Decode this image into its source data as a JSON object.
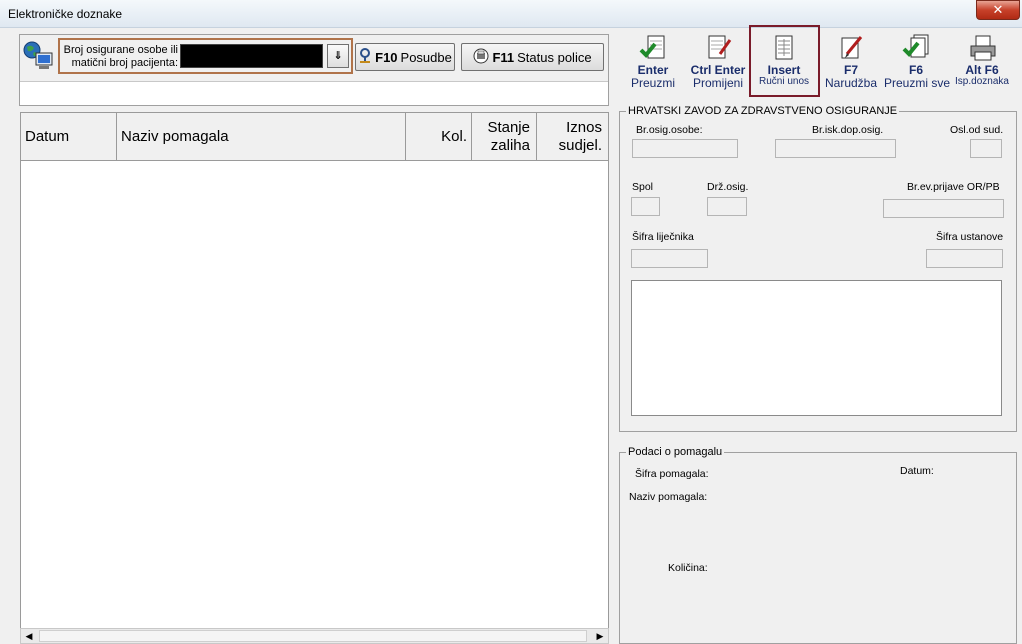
{
  "window": {
    "title": "Elektroničke doznake",
    "close_glyph": "✕"
  },
  "search": {
    "label": "Broj osigurane osobe ili matični broj pacijenta:",
    "value": "",
    "dropdown_glyph": "⇓"
  },
  "buttons": {
    "posudbe": {
      "key": "F10",
      "label": "Posudbe",
      "icon": "person-key-icon"
    },
    "status": {
      "key": "F11",
      "label": "Status police",
      "icon": "printer-circle-icon"
    }
  },
  "grid": {
    "columns": [
      "Datum",
      "Naziv pomagala",
      "Kol.",
      "Stanje zaliha",
      "Iznos sudjel."
    ],
    "rows": []
  },
  "toolbar": [
    {
      "key": "Enter",
      "label": "Preuzmi",
      "icon": "document-check-icon"
    },
    {
      "key": "Ctrl Enter",
      "label": "Promijeni",
      "icon": "document-edit-icon"
    },
    {
      "key": "Insert",
      "label": "Ručni unos",
      "icon": "document-grid-icon",
      "highlighted": true
    },
    {
      "key": "F7",
      "label": "Narudžba",
      "icon": "pencil-document-icon"
    },
    {
      "key": "F6",
      "label": "Preuzmi sve",
      "icon": "document-stack-check-icon"
    },
    {
      "key": "Alt F6",
      "label": "Isp.doznaka",
      "icon": "printer-icon"
    }
  ],
  "hzzo": {
    "legend": "HRVATSKI ZAVOD ZA ZDRAVSTVENO OSIGURANJE",
    "labels": {
      "br_osig": "Br.osig.osobe:",
      "br_isk": "Br.isk.dop.osig.",
      "osl": "Osl.od sud.",
      "spol": "Spol",
      "drz": "Drž.osig.",
      "br_ev": "Br.ev.prijave OR/PB",
      "sifra_lijecnika": "Šifra liječnika",
      "sifra_ustanove": "Šifra ustanove"
    }
  },
  "pomagalo": {
    "legend": "Podaci o pomagalu",
    "labels": {
      "sifra": "Šifra pomagala:",
      "datum": "Datum:",
      "naziv": "Naziv pomagala:",
      "kolicina": "Količina:"
    }
  }
}
